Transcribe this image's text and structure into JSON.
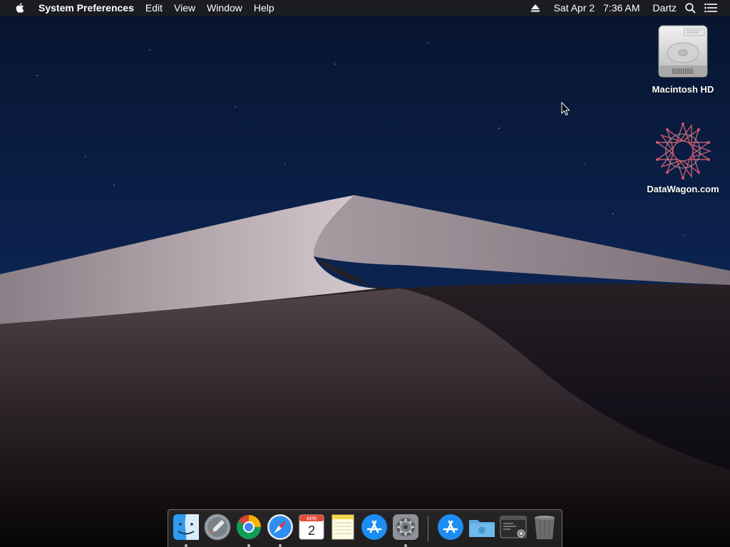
{
  "menubar": {
    "app_name": "System Preferences",
    "menus": [
      "Edit",
      "View",
      "Window",
      "Help"
    ],
    "status": {
      "date": "Sat Apr 2",
      "time": "7:36 AM",
      "user": "Dartz"
    }
  },
  "desktop": {
    "icons": [
      {
        "label": "Macintosh HD",
        "icon": "hard-drive-icon"
      },
      {
        "label": "DataWagon.com",
        "icon": "star-network-icon"
      }
    ]
  },
  "dock": {
    "items": [
      {
        "name": "finder-icon",
        "running": true
      },
      {
        "name": "launchpad-icon",
        "running": false
      },
      {
        "name": "chrome-icon",
        "running": true
      },
      {
        "name": "safari-icon",
        "running": true
      },
      {
        "name": "calendar-icon",
        "running": false,
        "month": "APR",
        "day": "2"
      },
      {
        "name": "notes-icon",
        "running": false
      },
      {
        "name": "app-store-icon",
        "running": false
      },
      {
        "name": "system-preferences-icon",
        "running": true
      },
      {
        "name": "applications-folder-icon",
        "running": false
      },
      {
        "name": "downloads-folder-icon",
        "running": false
      },
      {
        "name": "terminal-stack-icon",
        "running": false
      },
      {
        "name": "trash-icon",
        "running": false
      }
    ]
  },
  "colors": {
    "sky": "#0b1a3e",
    "dune_light": "#b4a8ad",
    "dune_shadow": "#1a1618",
    "menubar": "#1e1e1e"
  }
}
